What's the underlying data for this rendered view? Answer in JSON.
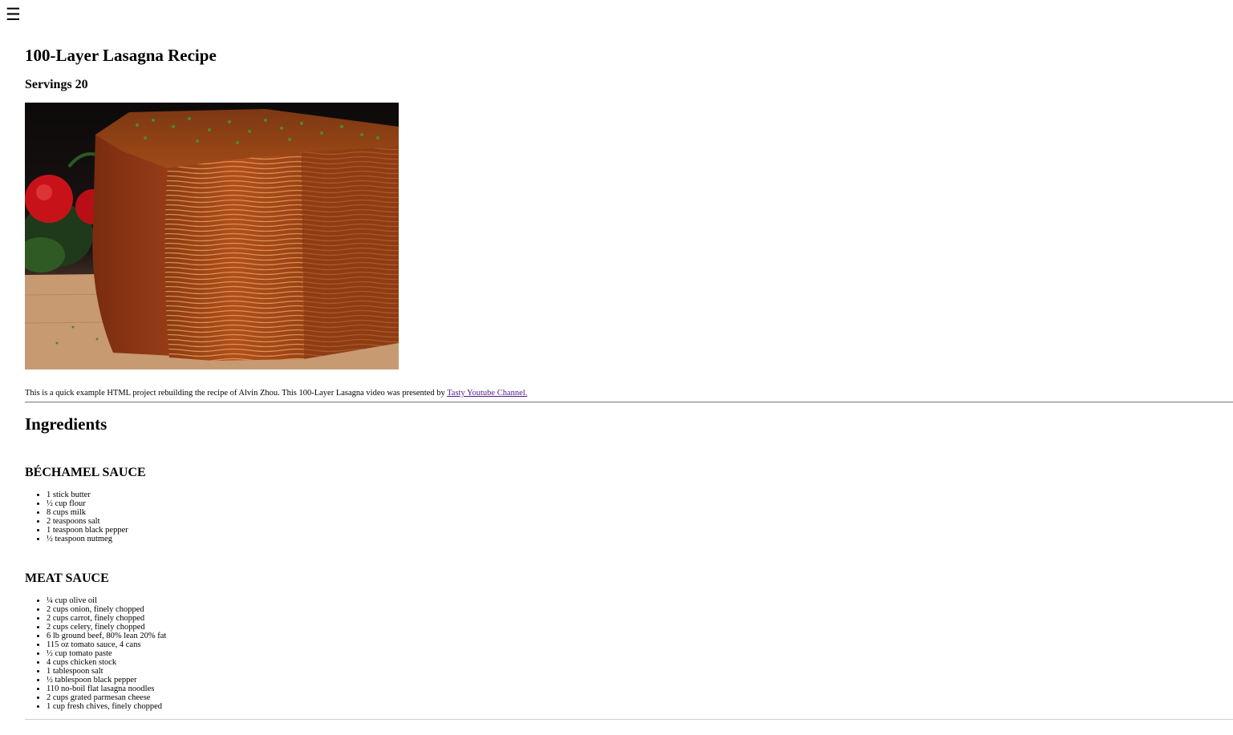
{
  "menu": {
    "icon": "hamburger-menu-icon",
    "glyph": "☰"
  },
  "recipe": {
    "title": "100-Layer Lasagna Recipe",
    "servings": "Servings 20",
    "intro_text": "This is a quick example HTML project rebuilding the recipe of Alvin Zhou. This 100-Layer Lasagna video was presented by ",
    "intro_link": "Tasty Youtube Channel."
  },
  "ingredients": {
    "heading": "Ingredients",
    "bechamel": {
      "heading": "BÉCHAMEL SAUCE",
      "items": [
        "1 stick butter",
        "½ cup flour",
        "8 cups milk",
        "2 teaspoons salt",
        "1 teaspoon black pepper",
        "½ teaspoon nutmeg"
      ]
    },
    "meat": {
      "heading": "MEAT SAUCE",
      "items": [
        "¼ cup olive oil",
        "2 cups onion, finely chopped",
        "2 cups carrot, finely chopped",
        "2 cups celery, finely chopped",
        "6 lb ground beef, 80% lean 20% fat",
        "115 oz tomato sauce, 4 cans",
        "½ cup tomato paste",
        "4 cups chicken stock",
        "1 tablespoon salt",
        "½ tablespoon black pepper",
        "110 no-boil flat lasagna noodles",
        "2 cups grated parmesan cheese",
        "1 cup fresh chives, finely chopped"
      ]
    }
  },
  "colors": {
    "link_visited": "#551a8b",
    "rule": "#888888"
  }
}
